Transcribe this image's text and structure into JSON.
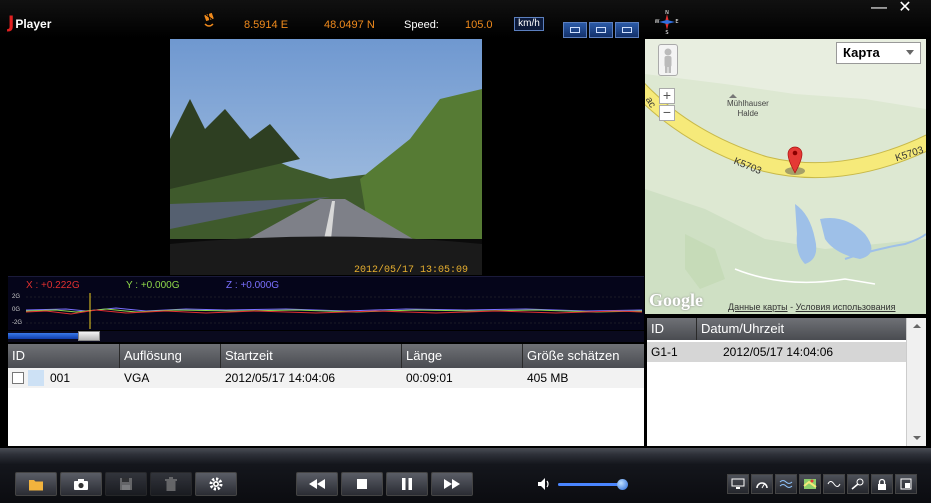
{
  "app": {
    "logo_letter": "J",
    "title": "Player"
  },
  "header": {
    "longitude": "8.5914 E",
    "latitude": "48.0497 N",
    "speed_label": "Speed:",
    "speed_value": "105.0",
    "speed_unit": "km/h",
    "compass_letters": [
      "N",
      "W",
      "E",
      "S"
    ]
  },
  "window": {
    "minimize": "—",
    "close": "✕"
  },
  "video": {
    "timestamp": "2012/05/17   13:05:09"
  },
  "gsensor": {
    "x_label": "X : +0.222G",
    "y_label": "Y : +0.000G",
    "z_label": "Z : +0.000G",
    "x_color": "#e03030",
    "y_color": "#8fd84a",
    "z_color": "#7a70ff",
    "axis_ticks": [
      "2G",
      "0G",
      "-2G"
    ]
  },
  "playback": {
    "progress": 0.11
  },
  "file_table": {
    "columns": [
      "ID",
      "Auflösung",
      "Startzeit",
      "Länge",
      "Größe schätzen"
    ],
    "rows": [
      {
        "id": "001",
        "resolution": "VGA",
        "start": "2012/05/17 14:04:06",
        "length": "00:09:01",
        "size": "405 MB"
      }
    ]
  },
  "map": {
    "type_label": "Карта",
    "place_name_1": "Mühlhauser",
    "place_name_2": "Halde",
    "road_left": "K5703",
    "road_right": "K5703",
    "road_edge": "ac",
    "google_logo": "Google",
    "data_link": "Данные карты",
    "separator": "-",
    "terms_link": "Условия использования",
    "zoom_in": "+",
    "zoom_out": "−"
  },
  "event_list": {
    "columns": [
      "ID",
      "Datum/Uhrzeit"
    ],
    "rows": [
      {
        "id": "G1-1",
        "datetime": "2012/05/17  14:04:06"
      }
    ]
  },
  "volume": {
    "level": 0.92
  },
  "colors": {
    "accent_orange": "#f08a1c",
    "progress_blue": "#2f6fe0",
    "map_road": "#f6ea7a"
  }
}
